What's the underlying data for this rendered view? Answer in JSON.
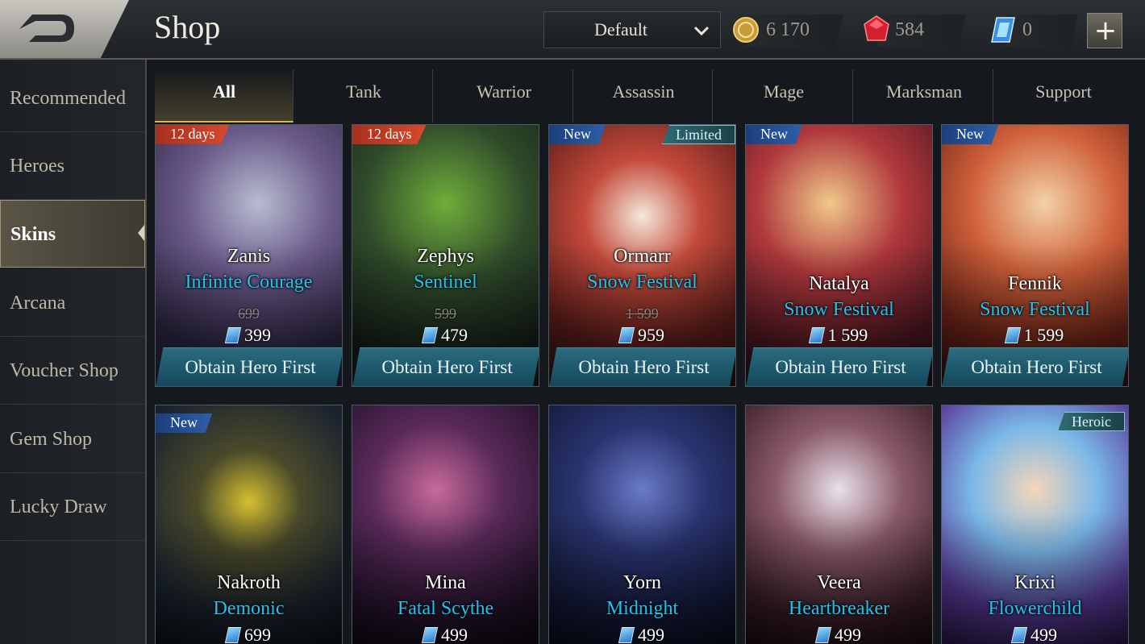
{
  "header": {
    "title": "Shop",
    "sort_value": "Default",
    "currencies": [
      {
        "icon": "gold-coin-icon",
        "amount": "6 170"
      },
      {
        "icon": "ruby-icon",
        "amount": "584"
      },
      {
        "icon": "voucher-icon",
        "amount": "0"
      }
    ],
    "plus_label": "+"
  },
  "sidebar": {
    "items": [
      {
        "label": "Recommended"
      },
      {
        "label": "Heroes"
      },
      {
        "label": "Skins",
        "active": true
      },
      {
        "label": "Arcana"
      },
      {
        "label": "Voucher Shop"
      },
      {
        "label": "Gem Shop"
      },
      {
        "label": "Lucky Draw"
      }
    ]
  },
  "tabs": [
    {
      "label": "All",
      "active": true
    },
    {
      "label": "Tank"
    },
    {
      "label": "Warrior"
    },
    {
      "label": "Assassin"
    },
    {
      "label": "Mage"
    },
    {
      "label": "Marksman"
    },
    {
      "label": "Support"
    }
  ],
  "cards": [
    {
      "hero": "Zanis",
      "skin": "Infinite Courage",
      "old_price": "699",
      "price": "399",
      "badge": "12 days",
      "button": "Obtain Hero First"
    },
    {
      "hero": "Zephys",
      "skin": "Sentinel",
      "old_price": "599",
      "price": "479",
      "badge": "12 days",
      "button": "Obtain Hero First"
    },
    {
      "hero": "Ormarr",
      "skin": "Snow Festival",
      "old_price": "1 599",
      "price": "959",
      "badge": "New",
      "rarity": "Limited",
      "button": "Obtain Hero First"
    },
    {
      "hero": "Natalya",
      "skin": "Snow Festival",
      "price": "1 599",
      "badge": "New",
      "button": "Obtain Hero First"
    },
    {
      "hero": "Fennik",
      "skin": "Snow Festival",
      "price": "1 599",
      "badge": "New",
      "button": "Obtain Hero First"
    },
    {
      "hero": "Nakroth",
      "skin": "Demonic",
      "price": "699",
      "badge": "New"
    },
    {
      "hero": "Mina",
      "skin": "Fatal Scythe",
      "price": "499"
    },
    {
      "hero": "Yorn",
      "skin": "Midnight",
      "price": "499"
    },
    {
      "hero": "Veera",
      "skin": "Heartbreaker",
      "price": "499"
    },
    {
      "hero": "Krixi",
      "skin": "Flowerchild",
      "price": "499",
      "rarity": "Heroic"
    }
  ],
  "colors": {
    "skin_name": "#21c4ef",
    "gold_accent": "#d9b55a",
    "button": "#1e5a6e"
  }
}
